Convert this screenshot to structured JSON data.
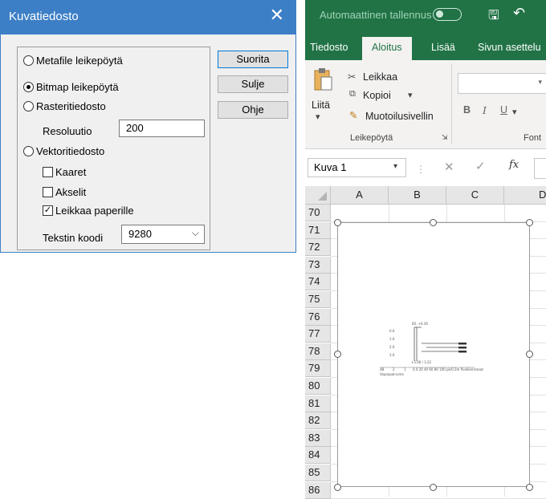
{
  "dialog": {
    "title": "Kuvatiedosto",
    "close_glyph": "✕",
    "options": {
      "metafile": "Metafile leikepöytä",
      "bitmap": "Bitmap leikepöytä",
      "raster": "Rasteritiedosto",
      "resolution_label": "Resoluutio",
      "resolution_value": "200",
      "vector": "Vektoritiedosto",
      "arcs": "Kaaret",
      "axes": "Akselit",
      "clip": "Leikkaa paperille",
      "text_code_label": "Tekstin koodi",
      "text_code_value": "9280"
    },
    "selected_option": "bitmap",
    "clip_checked": true,
    "buttons": {
      "run": "Suorita",
      "close": "Sulje",
      "help": "Ohje"
    }
  },
  "excel": {
    "autosave_label": "Automaattinen tallennus",
    "tabs": [
      "Tiedosto",
      "Aloitus",
      "Lisää",
      "Sivun asettelu"
    ],
    "active_tab": "Aloitus",
    "clipboard": {
      "paste": "Liitä",
      "cut": "Leikkaa",
      "copy": "Kopioi",
      "format_painter": "Muotoilusivellin",
      "group_label": "Leikepöytä"
    },
    "font_group_label": "Font",
    "font_buttons": [
      "B",
      "I",
      "U"
    ],
    "name_box": "Kuva 1",
    "fx_label": "fx",
    "columns": [
      "A",
      "B",
      "C",
      "D"
    ],
    "rows": [
      "70",
      "71",
      "72",
      "73",
      "74",
      "75",
      "76",
      "77",
      "78",
      "79",
      "80",
      "81",
      "82",
      "83",
      "84",
      "85",
      "86"
    ]
  },
  "colors": {
    "excel_green": "#217346",
    "dialog_blue": "#3d7fc6"
  }
}
